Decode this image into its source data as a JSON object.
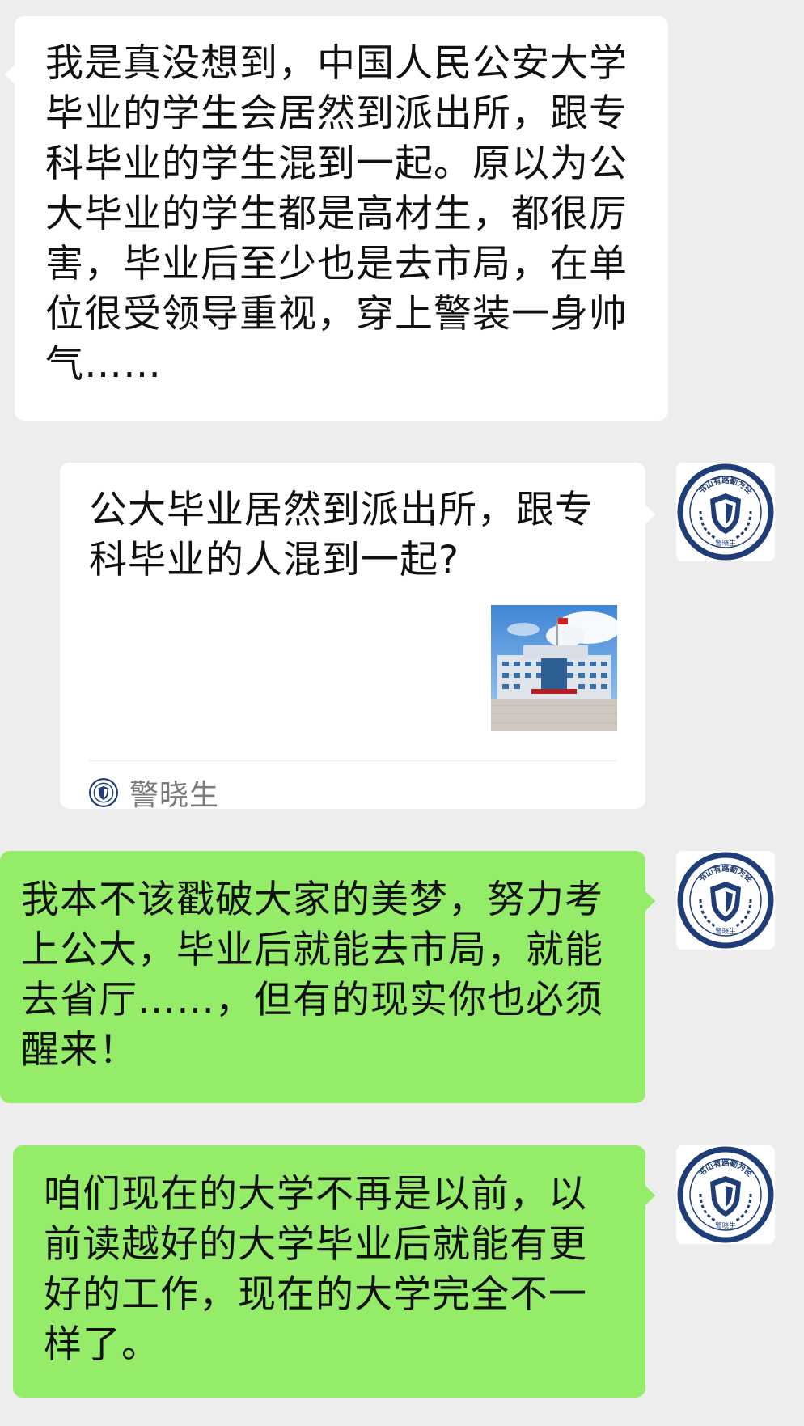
{
  "messages": [
    {
      "side": "left",
      "text": "我是真没想到，中国人民公安大学毕业的学生会居然到派出所，跟专科毕业的学生混到一起。原以为公大毕业的学生都是高材生，都很厉害，毕业后至少也是去市局，在单位很受领导重视，穿上警装一身帅气……"
    },
    {
      "side": "right",
      "type": "link-card",
      "title": "公大毕业居然到派出所，跟专科毕业的人混到一起?",
      "source_name": "警晓生"
    },
    {
      "side": "right",
      "text": "我本不该戳破大家的美梦，努力考上公大，毕业后就能去市局，就能去省厅……，但有的现实你也必须醒来！"
    },
    {
      "side": "right",
      "text": "咱们现在的大学不再是以前，以前读越好的大学毕业后就能有更好的工作，现在的大学完全不一样了。"
    }
  ],
  "avatar": {
    "arc_text": "书山有路勤为径",
    "bottom_text": "警晓生",
    "icon": "shield-badge-icon"
  },
  "colors": {
    "background": "#ededed",
    "incoming": "#ffffff",
    "outgoing": "#95ec69",
    "avatar_ring": "#1f3e78"
  }
}
